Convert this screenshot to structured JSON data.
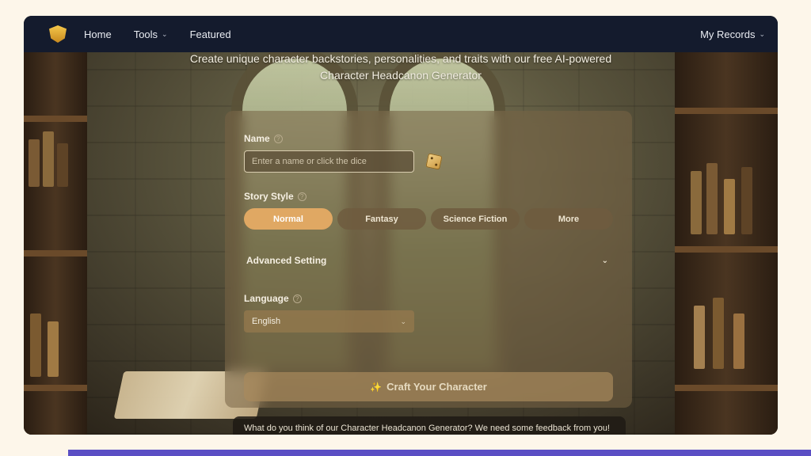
{
  "nav": {
    "home": "Home",
    "tools": "Tools",
    "featured": "Featured",
    "my_records": "My Records"
  },
  "tagline": {
    "line1": "Create unique character backstories, personalities, and traits with our free AI-powered",
    "line2": "Character Headcanon Generator"
  },
  "form": {
    "name_label": "Name",
    "name_placeholder": "Enter a name or click the dice",
    "name_value": "",
    "story_style_label": "Story Style",
    "styles": [
      {
        "label": "Normal",
        "active": true
      },
      {
        "label": "Fantasy",
        "active": false
      },
      {
        "label": "Science Fiction",
        "active": false
      },
      {
        "label": "More",
        "active": false
      }
    ],
    "advanced_label": "Advanced Setting",
    "language_label": "Language",
    "language_value": "English",
    "craft_label": "Craft Your Character"
  },
  "feedback": "What do you think of our Character Headcanon Generator? We need some feedback from you!",
  "colors": {
    "navbar": "#141b2d",
    "accent": "#e0a863",
    "page_bg": "#fdf6ea",
    "bottom_bar": "#5b4fc4"
  },
  "icons": {
    "logo": "shield-logo-icon",
    "dice": "dice-icon",
    "help": "help-circle-icon",
    "chevron": "chevron-down-icon",
    "sparkle": "sparkle-icon"
  }
}
